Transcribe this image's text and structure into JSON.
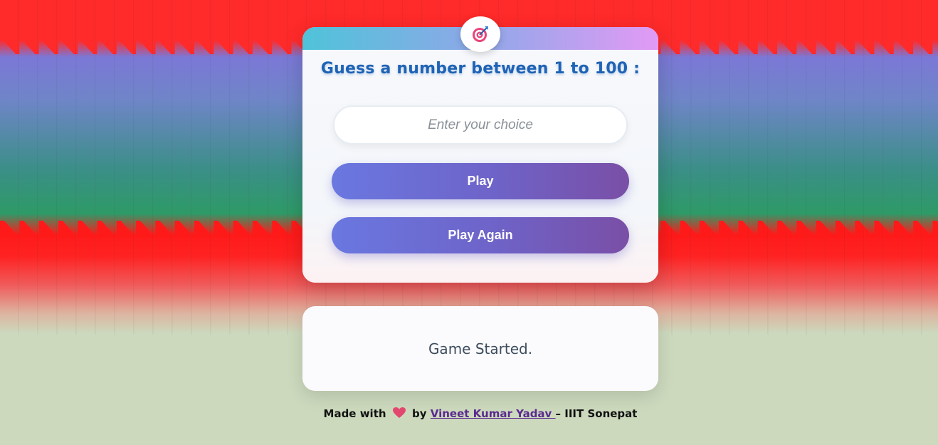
{
  "game": {
    "title": "Guess a number between 1 to 100 :",
    "badge_icon": "target-icon",
    "input": {
      "placeholder": "Enter your choice",
      "value": ""
    },
    "play_label": "Play",
    "play_again_label": "Play Again",
    "status_text": "Game Started."
  },
  "footer": {
    "made_with": "Made with",
    "heart_icon": "heart-icon",
    "by": "by",
    "author": "Vineet Kumar Yadav ",
    "suffix": "– IIIT Sonepat"
  },
  "colors": {
    "title": "#1f63b5",
    "button_start": "#6a78e0",
    "button_end": "#7a4fa6",
    "bg_red": "#ff2a2a",
    "bg_green": "#2e9a67",
    "bg_bottom": "#ccd9bd"
  }
}
